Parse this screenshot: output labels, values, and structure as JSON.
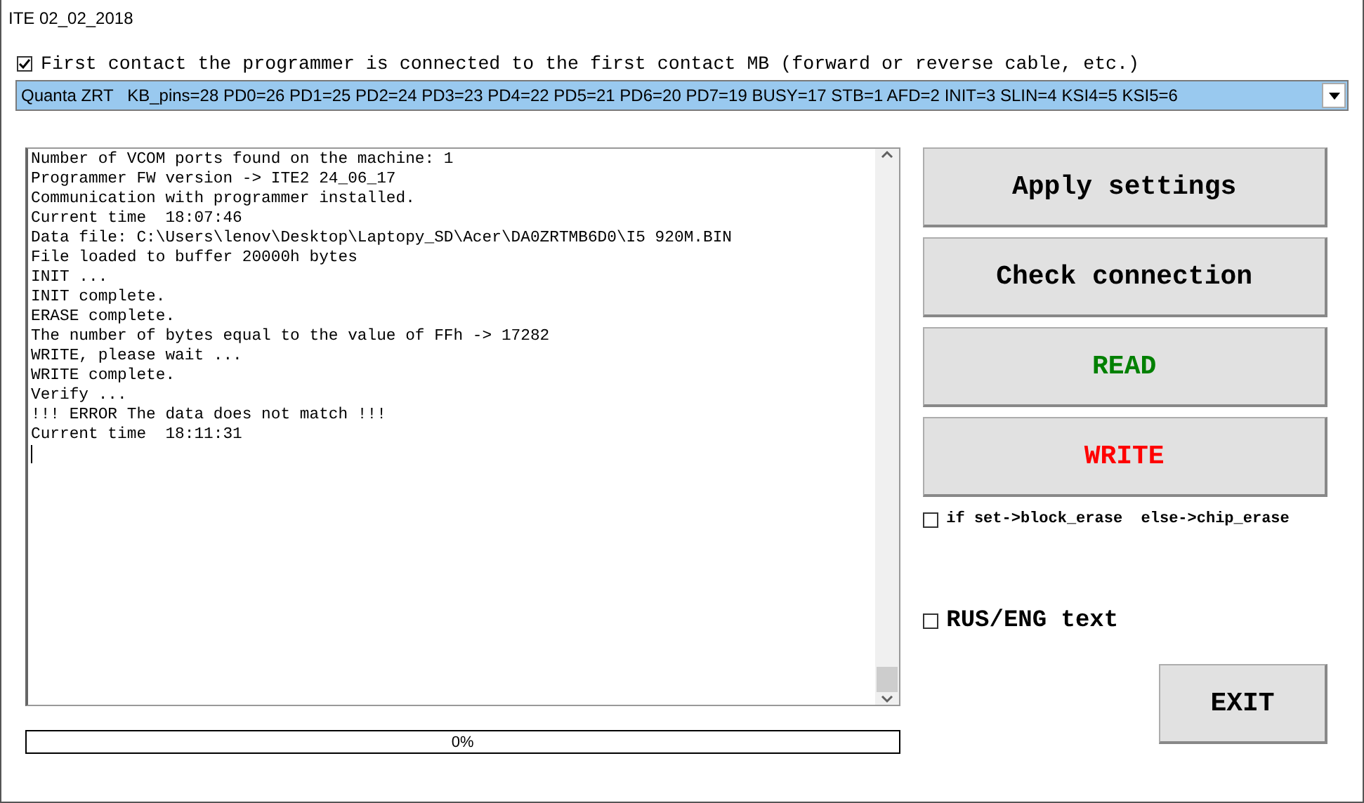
{
  "window": {
    "title": "ITE 02_02_2018"
  },
  "contact_option": {
    "label": "First contact the programmer is connected to the first contact MB (forward or reverse cable, etc.)",
    "checked": true
  },
  "pinout_select": {
    "value": "Quanta ZRT   KB_pins=28 PD0=26 PD1=25 PD2=24 PD3=23 PD4=22 PD5=21 PD6=20 PD7=19 BUSY=17 STB=1 AFD=2 INIT=3 SLIN=4 KSI4=5 KSI5=6"
  },
  "log": {
    "lines": [
      "Number of VCOM ports found on the machine: 1",
      "Programmer FW version -> ITE2 24_06_17",
      "Communication with programmer installed.",
      "Current time  18:07:46",
      "Data file: C:\\Users\\lenov\\Desktop\\Laptopy_SD\\Acer\\DA0ZRTMB6D0\\I5 920M.BIN",
      "File loaded to buffer 20000h bytes",
      "INIT ...",
      "INIT complete.",
      "ERASE complete.",
      "The number of bytes equal to the value of FFh -> 17282",
      "WRITE, please wait ...",
      "WRITE complete.",
      "Verify ...",
      "!!! ERROR The data does not match !!!",
      "Current time  18:11:31"
    ]
  },
  "progress": {
    "level": 0,
    "reading": "0%"
  },
  "buttons": [
    {
      "label": "Apply settings",
      "color": "#000000"
    },
    {
      "label": "Check connection",
      "color": "#000000"
    },
    {
      "label": "READ",
      "color": "#008000"
    },
    {
      "label": "WRITE",
      "color": "#ff0000"
    }
  ],
  "erase_option": {
    "label": "if set->block_erase  else->chip_erase",
    "checked": false
  },
  "language_option": {
    "label": "RUS/ENG text",
    "checked": false
  },
  "exit_button": {
    "label": "EXIT"
  }
}
